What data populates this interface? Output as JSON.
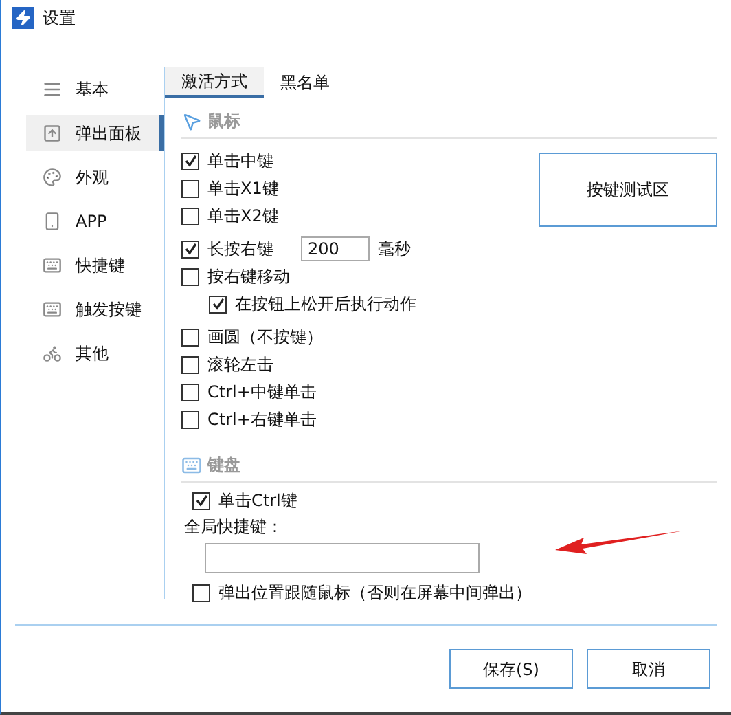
{
  "window": {
    "title": "设置"
  },
  "sidebar": {
    "items": [
      {
        "label": "基本",
        "selected": false
      },
      {
        "label": "弹出面板",
        "selected": true
      },
      {
        "label": "外观",
        "selected": false
      },
      {
        "label": "APP",
        "selected": false
      },
      {
        "label": "快捷键",
        "selected": false
      },
      {
        "label": "触发按键",
        "selected": false
      },
      {
        "label": "其他",
        "selected": false
      }
    ]
  },
  "tabs": [
    {
      "label": "激活方式",
      "selected": true
    },
    {
      "label": "黑名单",
      "selected": false
    }
  ],
  "mouse": {
    "heading": "鼠标",
    "test_area": "按键测试区",
    "groups": [
      [
        {
          "kind": "checkbox",
          "label": "单击中键",
          "checked": true
        },
        {
          "kind": "checkbox",
          "label": "单击X1键",
          "checked": false
        },
        {
          "kind": "checkbox",
          "label": "单击X2键",
          "checked": false
        }
      ],
      [
        {
          "kind": "duration",
          "label": "长按右键",
          "checked": true,
          "value": "200",
          "unit": "毫秒"
        },
        {
          "kind": "checkbox",
          "label": "按右键移动",
          "checked": false,
          "children": [
            {
              "kind": "checkbox",
              "label": "在按钮上松开后执行动作",
              "checked": true
            }
          ]
        }
      ],
      [
        {
          "kind": "checkbox",
          "label": "画圆（不按键）",
          "checked": false
        },
        {
          "kind": "checkbox",
          "label": "滚轮左击",
          "checked": false
        },
        {
          "kind": "checkbox",
          "label": "Ctrl+中键单击",
          "checked": false
        },
        {
          "kind": "checkbox",
          "label": "Ctrl+右键单击",
          "checked": false
        }
      ]
    ]
  },
  "keyboard": {
    "heading": "键盘",
    "ctrl": {
      "label": "单击Ctrl键",
      "checked": true
    },
    "hotkey_label": "全局快捷键：",
    "follow": {
      "label": "弹出位置跟随鼠标（否则在屏幕中间弹出）",
      "checked": false
    }
  },
  "buttons": [
    {
      "label": "保存(S)"
    },
    {
      "label": "取消"
    }
  ]
}
